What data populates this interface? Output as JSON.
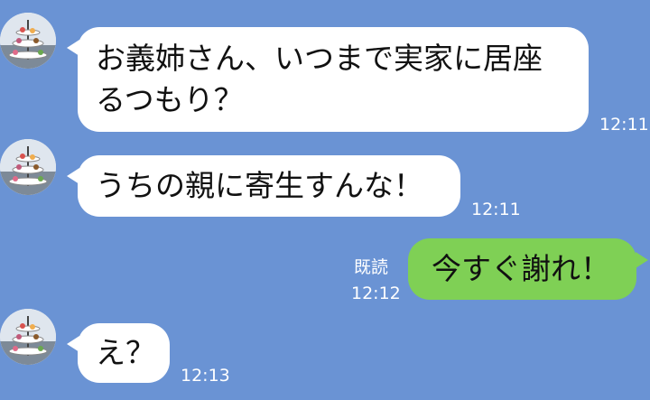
{
  "messages": [
    {
      "sender": "other",
      "text": "お義姉さん、いつまで実家に居座るつもり？",
      "time": "12:11"
    },
    {
      "sender": "other",
      "text": "うちの親に寄生すんな！",
      "time": "12:11"
    },
    {
      "sender": "me",
      "text": "今すぐ謝れ！",
      "time": "12:12",
      "read_label": "既読"
    },
    {
      "sender": "other",
      "text": "え？",
      "time": "12:13"
    }
  ],
  "colors": {
    "background": "#6a93d4",
    "incoming_bubble": "#ffffff",
    "outgoing_bubble": "#7fd055",
    "timestamp": "#ffffff"
  },
  "icons": {
    "avatar": "afternoon-tea-stand-avatar"
  }
}
